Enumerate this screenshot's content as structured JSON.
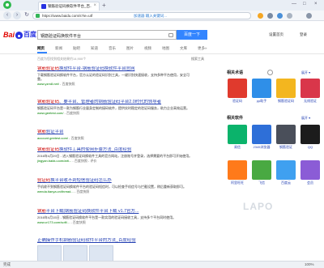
{
  "browser": {
    "tab_title": "钢筋验证码换软件平台_百...",
    "tab_close": "×",
    "new_tab": "+",
    "url_main": "https://www.baidu.com/s?ie=utf",
    "url_sub": "加速器  输入关键词...",
    "win_min": "—",
    "win_max": "□",
    "win_close": "×"
  },
  "baidu": {
    "logo_left": "Bai",
    "logo_right": "百度",
    "search_value": "钢筋验证码换软件平台",
    "search_button": "百度一下",
    "header_links": [
      "设置首页",
      "登录"
    ],
    "tabs": [
      "网页",
      "新闻",
      "贴吧",
      "知道",
      "音乐",
      "图片",
      "视频",
      "地图",
      "文库",
      "更多»"
    ],
    "result_count": "百度为您找到相关结果约14,900个",
    "search_tool": "搜索工具"
  },
  "results": [
    {
      "title_em": "钢筋验证码",
      "title_rest": "换软件平台-钢筋验证码换软件平台官网",
      "desc": "下载钢筋验证码换软件平台，官方认证的验证码识别工具，一键识别快速接收，支持多种平台使用，安全可靠。",
      "url": "www.yzm8.net/",
      "snap": "- 百度快照"
    },
    {
      "title_em": "钢筋验证码",
      "title_rest": "、要平台、管理者的钢筋验证码平台2.0时代的领导者",
      "desc": "钢筋验证码平台是一款为钢筋行业量身定制的接码软件，提供实时稳定的验证码服务，助力企业高效运营。",
      "url": "www.geetest.com/",
      "snap": "- 百度快照"
    },
    {
      "title_em": "钢筋",
      "title_rest": "验证平台",
      "desc": "",
      "url": "account.geetest.com/",
      "snap": "- 百度快照"
    },
    {
      "title_em": "钢筋验证码",
      "title_rest": "换软件工具的使用步骤方法_百度经验",
      "desc": "2016年4月29日 - 进入钢筋验证码换软件工具的官方网站，注册账号并登录，选择需要的平台即可开始使用。",
      "url": "jingyan.baidu.com/arti...",
      "snap": "- 百度快照 - 评价"
    },
    {
      "title_em": "验证码",
      "title_rest": "换平台收不到短信验证码怎么办",
      "desc": "手机收不到钢筋验证码换软件平台的验证码短信时，可以检查手机信号与拦截设置，稍后重新获取即可。",
      "url": "wenda.tianya.cn/thread...",
      "snap": "- 百度快照"
    },
    {
      "title_em": "钢筋",
      "title_rest": "平台下载|钢筋验证码换软件平台下载 v1.7官方...",
      "desc": "2016年4月15日 - 钢筋验证码换软件平台是一款实用的验证码接收工具，支持多个平台同时使用。",
      "url": "www.cr173.com/soft/...",
      "snap": "- 百度快照"
    },
    {
      "title_em": "",
      "title_rest": "正确操作手机钢筋验证码软件平台的方法_百度经验",
      "desc": "",
      "url": "",
      "snap": ""
    }
  ],
  "right": {
    "sec1_title": "相关术语",
    "sec1_more": "展开 ▾",
    "sec1_cards": [
      "验证码",
      "pp助手",
      "钢筋验证码",
      "无线验证"
    ],
    "sec2_title": "相关软件",
    "sec2_more": "展开 ▾",
    "sec2_cards": [
      "易信",
      "2345浏览器",
      "钢筋验证",
      "QQ",
      "阿里旺旺",
      "飞信",
      "百度云",
      "会员"
    ]
  },
  "watermark": "LAPO",
  "status": {
    "left": "完成",
    "right": "100%"
  },
  "colors": {
    "accent": "#3385ff",
    "link": "#2440b3",
    "highlight": "#c00000",
    "url_green": "#008000"
  }
}
